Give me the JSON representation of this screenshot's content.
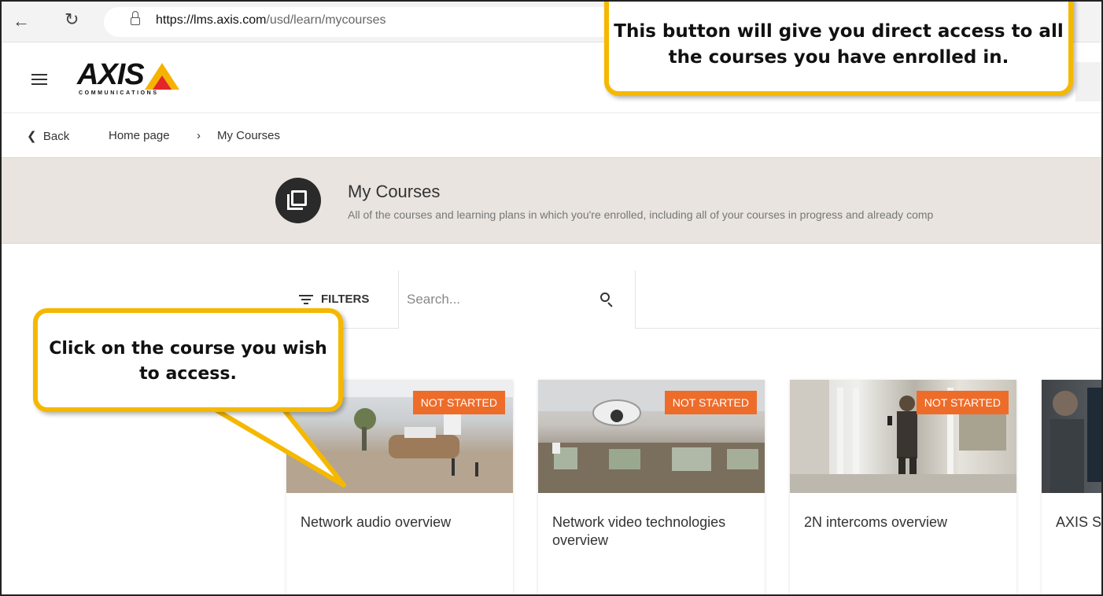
{
  "browser": {
    "url_host": "https://lms.axis.com",
    "url_path": "/usd/learn/mycourses"
  },
  "header": {
    "logo_text": "AXIS",
    "logo_subtext": "COMMUNICATIONS"
  },
  "breadcrumb": {
    "back_label": "Back",
    "items": [
      "Home page",
      "My Courses"
    ],
    "separator": "›"
  },
  "banner": {
    "title": "My Courses",
    "subtitle": "All of the courses and learning plans in which you're enrolled, including all of your courses in progress and already comp"
  },
  "filters": {
    "label": "FILTERS",
    "search_placeholder": "Search..."
  },
  "courses": [
    {
      "title": "Network audio overview",
      "status": "NOT STARTED"
    },
    {
      "title": "Network video technologies overview",
      "status": "NOT STARTED"
    },
    {
      "title": "2N intercoms overview",
      "status": "NOT STARTED"
    },
    {
      "title": "AXIS S",
      "status": ""
    }
  ],
  "callouts": {
    "top": "This button will give you direct access to all the courses you have enrolled in.",
    "left": "Click on the course you wish to access."
  },
  "colors": {
    "accent_callout": "#f5b800",
    "badge": "#ee6c2a",
    "banner_bg": "#e9e4df"
  },
  "icons": [
    "back-arrow-icon",
    "reload-icon",
    "lock-icon",
    "hamburger-icon",
    "chevron-left-icon",
    "my-courses-icon",
    "filter-icon",
    "search-icon"
  ]
}
